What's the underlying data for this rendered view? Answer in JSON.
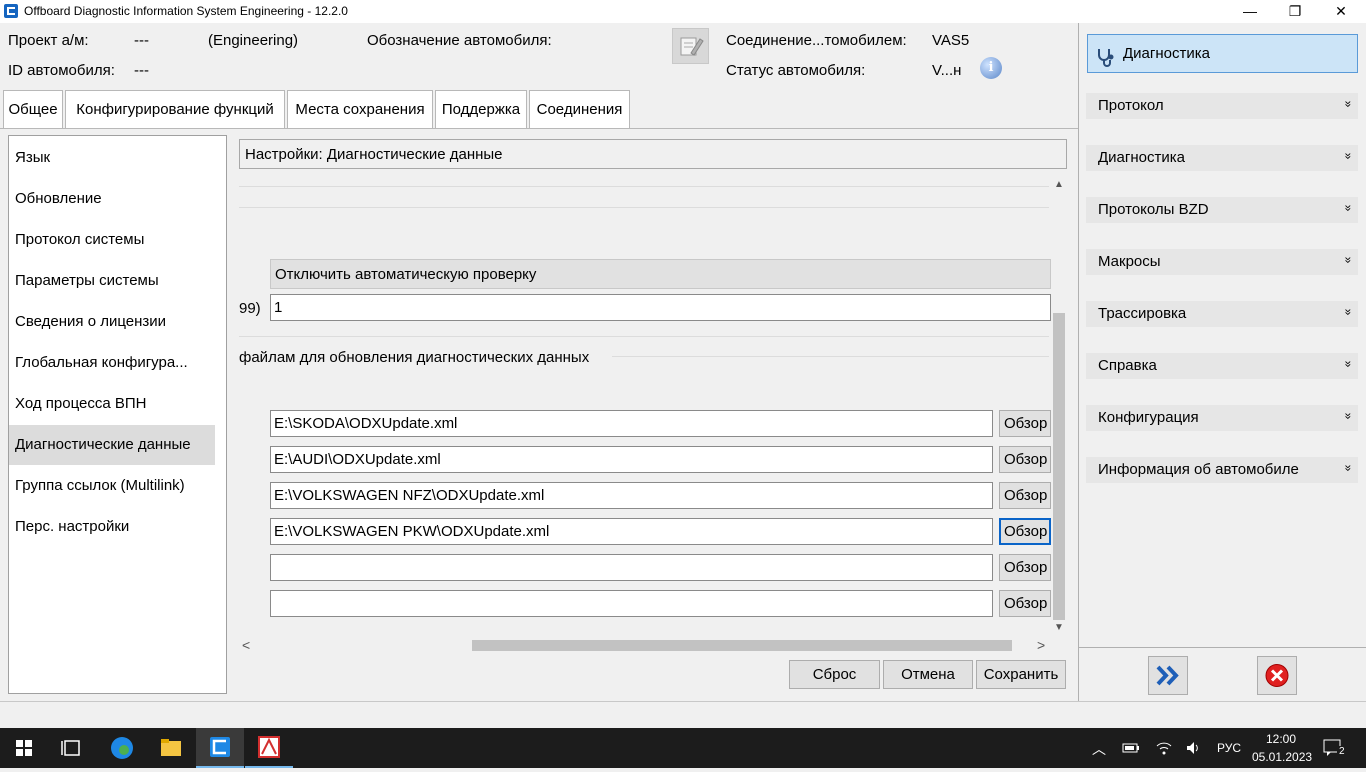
{
  "window": {
    "title": "Offboard Diagnostic Information System Engineering - 12.2.0",
    "minimize": "—",
    "maximize": "❐",
    "close": "✕"
  },
  "header": {
    "project_label": "Проект а/м:",
    "project_value": "---",
    "mode": "(Engineering)",
    "vehicle_designation_label": "Обозначение автомобиля:",
    "vehicle_id_label": "ID автомобиля:",
    "vehicle_id_value": "---",
    "connection_label": "Соединение...томобилем:",
    "connection_value": "VAS5",
    "status_label": "Статус автомобиля:",
    "status_value": "V...н",
    "info_glyph": "i"
  },
  "tabs": [
    "Общее",
    "Конфигурирование функций",
    "Места сохранения",
    "Поддержка",
    "Соединения"
  ],
  "nav": {
    "items": [
      "Язык",
      "Обновление",
      "Протокол системы",
      "Параметры системы",
      "Сведения о лицензии",
      "Глобальная конфигура...",
      "Ход процесса ВПН",
      "Диагностические данные",
      "Группа ссылок (Multilink)",
      "Перс. настройки"
    ],
    "selected_index": 7
  },
  "content": {
    "section_title": "Настройки: Диагностические данные",
    "auto_check_button": "Отключить автоматическую проверку",
    "count_label_fragment": "99)",
    "count_value": "1",
    "paths_group_label": "файлам для обновления диагностических данных",
    "paths": [
      "E:\\SKODA\\ODXUpdate.xml",
      "E:\\AUDI\\ODXUpdate.xml",
      "E:\\VOLKSWAGEN NFZ\\ODXUpdate.xml",
      "E:\\VOLKSWAGEN PKW\\ODXUpdate.xml",
      "",
      ""
    ],
    "browse_label": "Обзор",
    "scroll_up": "▲",
    "scroll_down": "▼",
    "scroll_left": "<",
    "scroll_right": ">"
  },
  "actions": {
    "reset": "Сброс",
    "cancel": "Отмена",
    "save": "Сохранить"
  },
  "right_panel": {
    "diagnostics_button": "Диагностика",
    "sections": [
      "Протокол",
      "Диагностика",
      "Протоколы BZD",
      "Макросы",
      "Трассировка",
      "Справка",
      "Конфигурация",
      "Информация об автомобиле"
    ],
    "chevron": "»"
  },
  "taskbar": {
    "language": "РУС",
    "time": "12:00",
    "date": "05.01.2023",
    "notifications": "2"
  },
  "colors": {
    "accent": "#0a64c8",
    "diag_button_bg": "#cce4f7",
    "taskbar_bg": "#1c1c1c"
  }
}
